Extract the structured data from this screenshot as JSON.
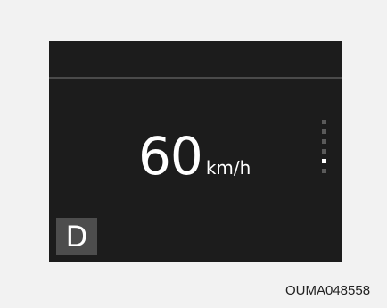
{
  "display": {
    "speed": {
      "value": "60",
      "unit": "km/h"
    },
    "gear": "D",
    "level_indicator": {
      "segments": 6,
      "active_segment": 5
    }
  },
  "reference_code": "OUMA048558"
}
